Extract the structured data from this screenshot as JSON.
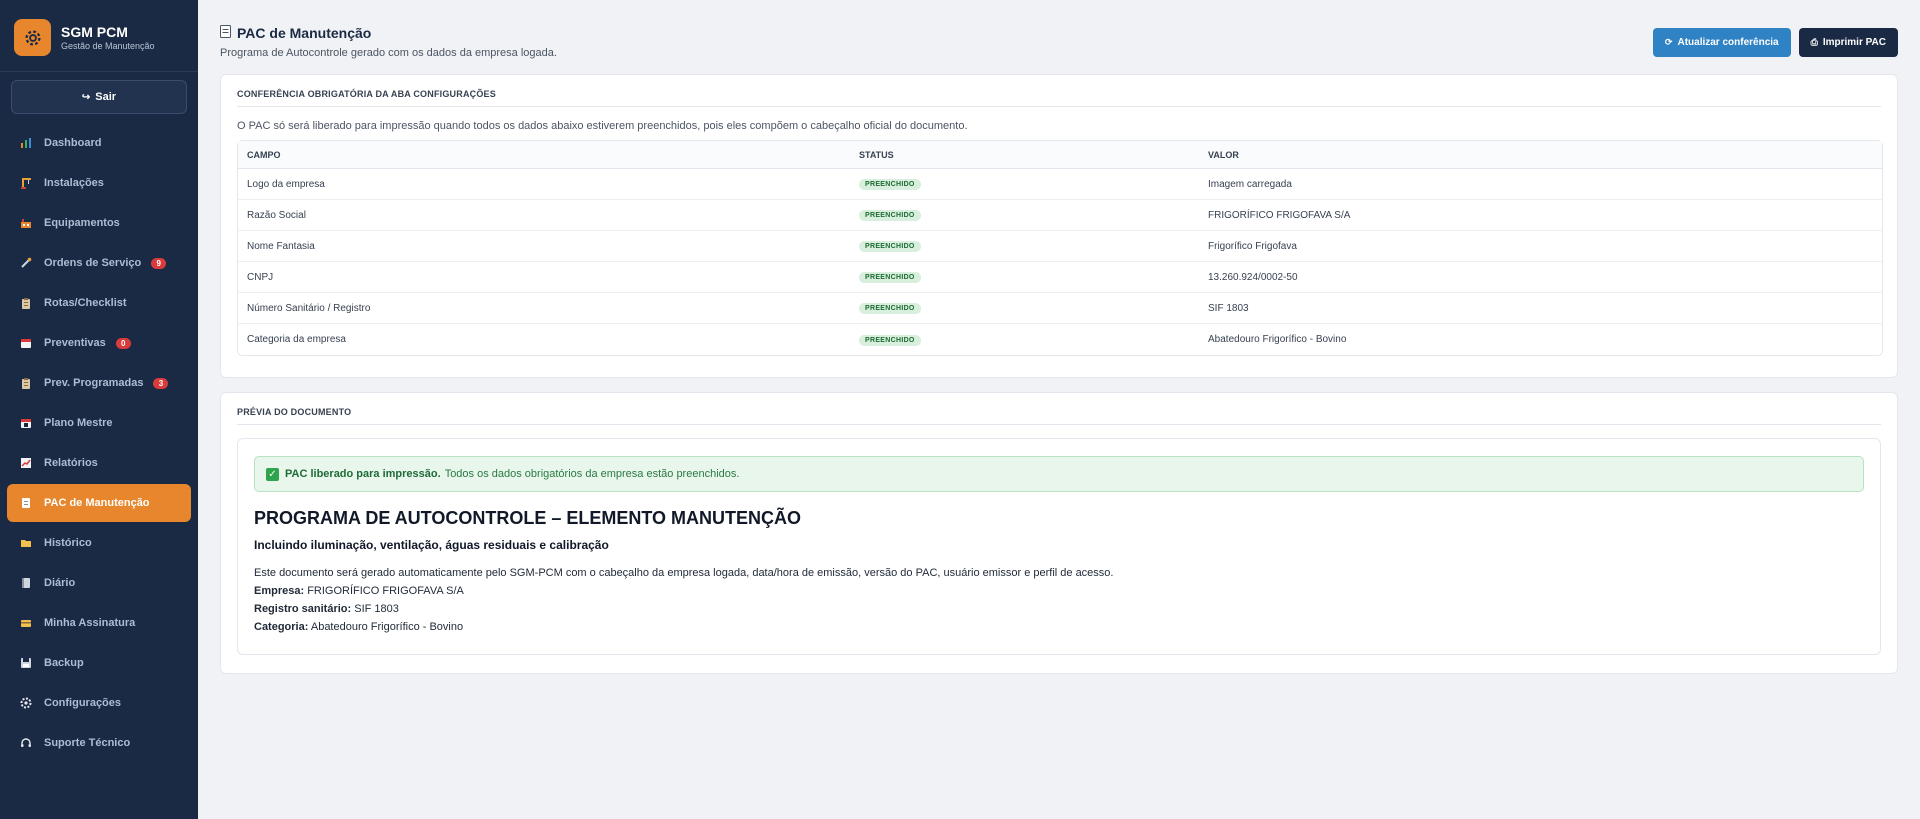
{
  "brand": {
    "title": "SGM PCM",
    "subtitle": "Gestão de Manutenção"
  },
  "logout_label": "Sair",
  "nav": [
    {
      "label": "Dashboard",
      "icon": "chart-icon",
      "badge": ""
    },
    {
      "label": "Instalações",
      "icon": "crane-icon",
      "badge": ""
    },
    {
      "label": "Equipamentos",
      "icon": "factory-icon",
      "badge": ""
    },
    {
      "label": "Ordens de Serviço",
      "icon": "wrench-icon",
      "badge": "9"
    },
    {
      "label": "Rotas/Checklist",
      "icon": "clipboard-icon",
      "badge": ""
    },
    {
      "label": "Preventivas",
      "icon": "calendar-icon",
      "badge": "0"
    },
    {
      "label": "Prev. Programadas",
      "icon": "clipboard-icon",
      "badge": "3"
    },
    {
      "label": "Plano Mestre",
      "icon": "calendar-icon",
      "badge": ""
    },
    {
      "label": "Relatórios",
      "icon": "trend-icon",
      "badge": ""
    },
    {
      "label": "PAC de Manutenção",
      "icon": "document-icon",
      "badge": "",
      "active": true
    },
    {
      "label": "Histórico",
      "icon": "folder-icon",
      "badge": ""
    },
    {
      "label": "Diário",
      "icon": "notebook-icon",
      "badge": ""
    },
    {
      "label": "Minha Assinatura",
      "icon": "card-icon",
      "badge": ""
    },
    {
      "label": "Backup",
      "icon": "save-icon",
      "badge": ""
    },
    {
      "label": "Configurações",
      "icon": "gear-icon",
      "badge": ""
    },
    {
      "label": "Suporte Técnico",
      "icon": "headset-icon",
      "badge": ""
    }
  ],
  "page": {
    "title": "PAC de Manutenção",
    "subtitle": "Programa de Autocontrole gerado com os dados da empresa logada."
  },
  "actions": {
    "refresh_label": "Atualizar conferência",
    "print_label": "Imprimir PAC"
  },
  "check": {
    "title": "CONFERÊNCIA OBRIGATÓRIA DA ABA CONFIGURAÇÕES",
    "description": "O PAC só será liberado para impressão quando todos os dados abaixo estiverem preenchidos, pois eles compõem o cabeçalho oficial do documento.",
    "columns": [
      "CAMPO",
      "STATUS",
      "VALOR"
    ],
    "rows": [
      {
        "field": "Logo da empresa",
        "status": "PREENCHIDO",
        "value": "Imagem carregada"
      },
      {
        "field": "Razão Social",
        "status": "PREENCHIDO",
        "value": "FRIGORÍFICO FRIGOFAVA S/A"
      },
      {
        "field": "Nome Fantasia",
        "status": "PREENCHIDO",
        "value": "Frigorífico Frigofava"
      },
      {
        "field": "CNPJ",
        "status": "PREENCHIDO",
        "value": "13.260.924/0002-50"
      },
      {
        "field": "Número Sanitário / Registro",
        "status": "PREENCHIDO",
        "value": "SIF 1803"
      },
      {
        "field": "Categoria da empresa",
        "status": "PREENCHIDO",
        "value": "Abatedouro Frigorífico - Bovino"
      }
    ]
  },
  "preview": {
    "title": "PRÉVIA DO DOCUMENTO",
    "alert_strong": "PAC liberado para impressão.",
    "alert_text": "Todos os dados obrigatórios da empresa estão preenchidos.",
    "doc_title": "PROGRAMA DE AUTOCONTROLE – ELEMENTO MANUTENÇÃO",
    "doc_subtitle": "Incluindo iluminação, ventilação, águas residuais e calibração",
    "doc_paragraph": "Este documento será gerado automaticamente pelo SGM-PCM com o cabeçalho da empresa logada, data/hora de emissão, versão do PAC, usuário emissor e perfil de acesso.",
    "company_label": "Empresa:",
    "company_value": "FRIGORÍFICO FRIGOFAVA S/A",
    "registry_label": "Registro sanitário:",
    "registry_value": "SIF 1803",
    "category_label": "Categoria:",
    "category_value": "Abatedouro Frigorífico - Bovino"
  }
}
